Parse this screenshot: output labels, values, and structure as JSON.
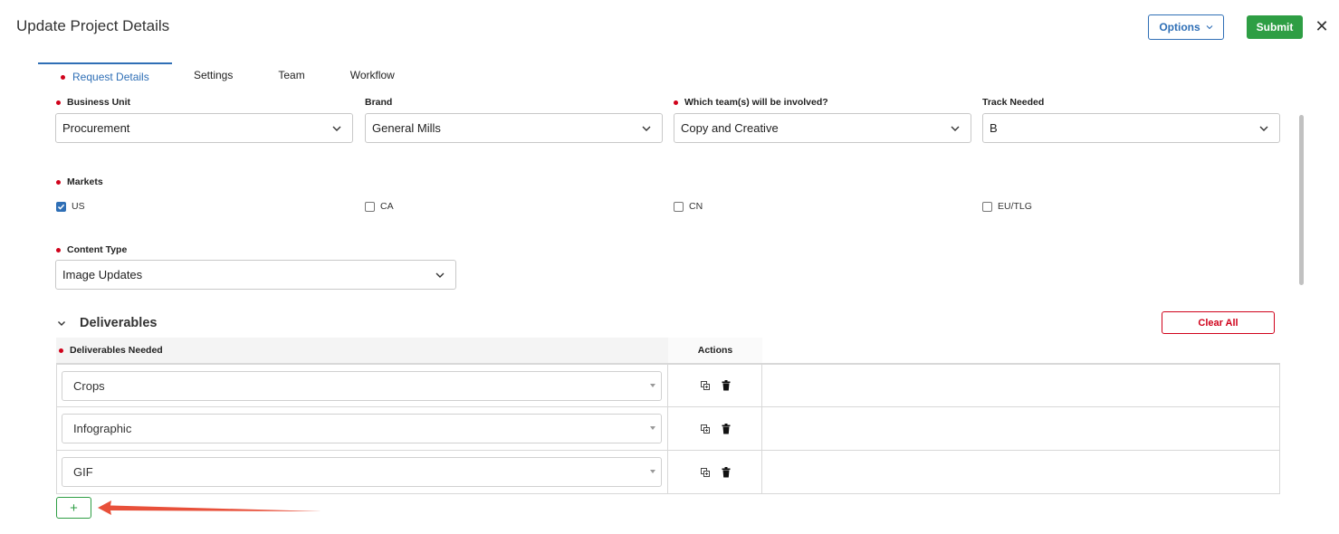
{
  "header": {
    "title": "Update Project Details",
    "options_label": "Options",
    "submit_label": "Submit",
    "close_glyph": "✕"
  },
  "tabs": [
    {
      "label": "Request Details",
      "active": true,
      "required": true
    },
    {
      "label": "Settings"
    },
    {
      "label": "Team"
    },
    {
      "label": "Workflow"
    }
  ],
  "form": {
    "business_unit": {
      "label": "Business Unit",
      "value": "Procurement",
      "required": true
    },
    "brand": {
      "label": "Brand",
      "value": "General Mills"
    },
    "teams": {
      "label": "Which team(s) will be involved?",
      "value": "Copy and Creative",
      "required": true
    },
    "track": {
      "label": "Track Needed",
      "value": "B"
    },
    "markets": {
      "label": "Markets",
      "required": true,
      "options": [
        {
          "label": "US",
          "checked": true
        },
        {
          "label": "CA",
          "checked": false
        },
        {
          "label": "CN",
          "checked": false
        },
        {
          "label": "EU/TLG",
          "checked": false
        }
      ]
    },
    "content_type": {
      "label": "Content Type",
      "value": "Image Updates",
      "required": true
    }
  },
  "deliverables": {
    "section_title": "Deliverables",
    "clear_all_label": "Clear All",
    "col_needed": "Deliverables Needed",
    "col_actions": "Actions",
    "rows": [
      {
        "value": "Crops"
      },
      {
        "value": "Infographic"
      },
      {
        "value": "GIF"
      }
    ],
    "add_label": "+"
  },
  "colors": {
    "accent_blue": "#2f6fb6",
    "submit_green": "#2e9e44",
    "required_red": "#d0021b",
    "annotation_arrow": "#e8503a"
  }
}
